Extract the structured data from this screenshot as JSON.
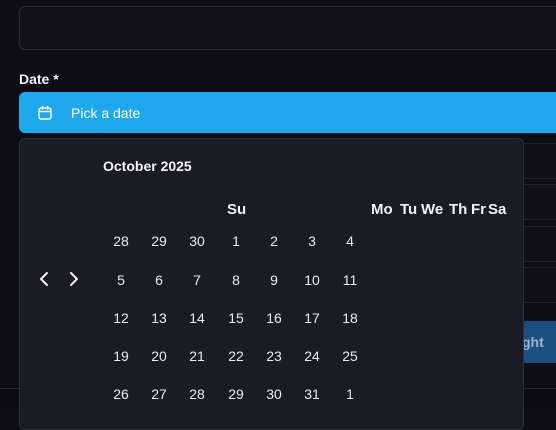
{
  "form": {
    "date_label": "Date *",
    "date_placeholder": "Pick a date",
    "obscured_button_text": "ght"
  },
  "calendar": {
    "month_caption": "October 2025",
    "weekdays": [
      "Su",
      "Mo",
      "Tu",
      "We",
      "Th",
      "Fr",
      "Sa"
    ],
    "weeks": [
      [
        "28",
        "29",
        "30",
        "1",
        "2",
        "3",
        "4"
      ],
      [
        "5",
        "6",
        "7",
        "8",
        "9",
        "10",
        "11"
      ],
      [
        "12",
        "13",
        "14",
        "15",
        "16",
        "17",
        "18"
      ],
      [
        "19",
        "20",
        "21",
        "22",
        "23",
        "24",
        "25"
      ],
      [
        "26",
        "27",
        "28",
        "29",
        "30",
        "31",
        "1"
      ]
    ]
  },
  "colors": {
    "accent": "#1ea7ec",
    "popover_bg": "#181c24",
    "page_bg": "#0b0e14"
  },
  "icons": {
    "date_trigger": "calendar-icon",
    "prev": "chevron-left-icon",
    "next": "chevron-right-icon"
  }
}
